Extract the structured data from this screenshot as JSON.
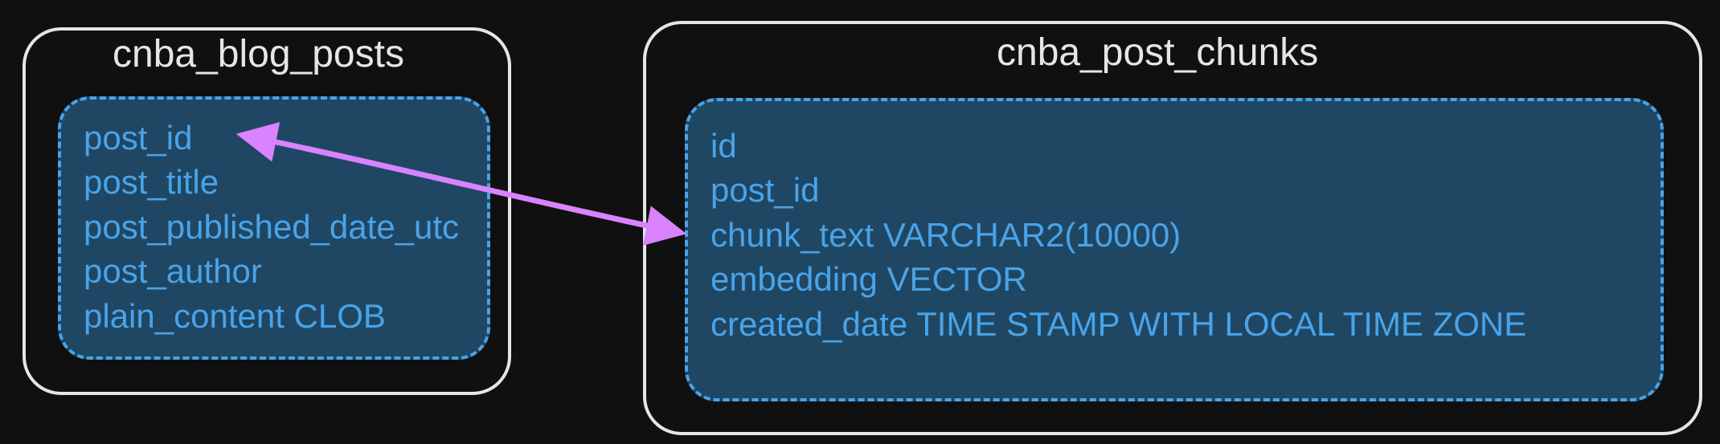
{
  "tables": {
    "left": {
      "title": "cnba_blog_posts",
      "columns": [
        "post_id",
        "post_title",
        "post_published_date_utc",
        "post_author",
        "plain_content CLOB"
      ]
    },
    "right": {
      "title": "cnba_post_chunks",
      "columns": [
        "id",
        "post_id",
        "chunk_text VARCHAR2(10000)",
        "embedding VECTOR",
        "created_date TIME STAMP WITH LOCAL TIME ZONE"
      ]
    }
  },
  "relationship": {
    "from": "cnba_blog_posts.post_id",
    "to": "cnba_post_chunks.post_id"
  }
}
